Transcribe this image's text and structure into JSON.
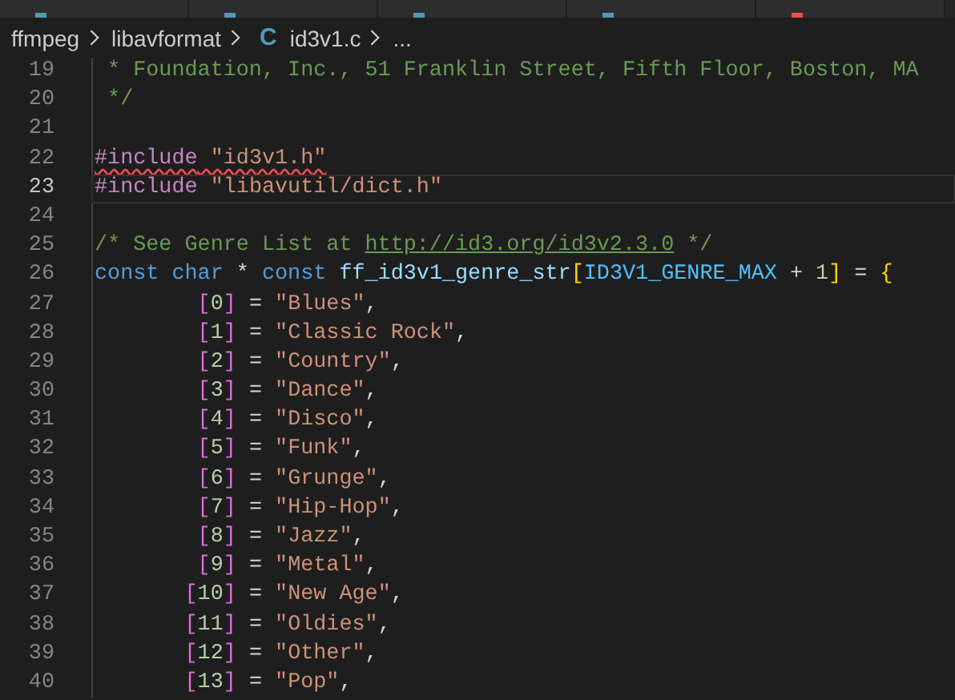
{
  "tabs": [
    {
      "modified": false
    },
    {
      "modified": false
    },
    {
      "modified": false
    },
    {
      "modified": false
    },
    {
      "modified": true
    }
  ],
  "breadcrumbs": {
    "items": [
      "ffmpeg",
      "libavformat"
    ],
    "file_icon": "C",
    "file": "id3v1.c",
    "more": "..."
  },
  "editor": {
    "lines": [
      {
        "number": "19",
        "current": false,
        "error": false,
        "tokens": [
          {
            "kind": "comment",
            "text": " * Foundation, Inc., 51 Franklin Street, Fifth Floor, Boston, MA"
          }
        ]
      },
      {
        "number": "20",
        "current": false,
        "error": false,
        "tokens": [
          {
            "kind": "comment",
            "text": " */"
          }
        ]
      },
      {
        "number": "21",
        "current": false,
        "error": false
      },
      {
        "number": "22",
        "current": false,
        "error": true,
        "tokens": [
          {
            "kind": "preproc",
            "text": "#include"
          },
          {
            "kind": "string",
            "text": " \"id3v1.h\""
          }
        ]
      },
      {
        "number": "23",
        "current": true,
        "error": false,
        "tokens": [
          {
            "kind": "preproc",
            "text": "#include"
          },
          {
            "kind": "string",
            "text": " \"libavutil/dict.h\""
          }
        ]
      },
      {
        "number": "24",
        "current": false,
        "error": false
      },
      {
        "number": "25",
        "current": false,
        "error": false,
        "tokens": [
          {
            "kind": "comment",
            "text": "/* See Genre List at "
          },
          {
            "kind": "link",
            "text": "http://id3.org/id3v2.3.0"
          },
          {
            "kind": "comment",
            "text": " */"
          }
        ]
      },
      {
        "number": "26",
        "current": false,
        "error": false,
        "tokens": [
          {
            "kind": "keyword",
            "text": "const char"
          },
          {
            "kind": "plain",
            "text": " * "
          },
          {
            "kind": "keyword",
            "text": "const"
          },
          {
            "kind": "variable",
            "text": " ff_id3v1_genre_str"
          },
          {
            "kind": "bracket",
            "text": "["
          },
          {
            "kind": "macro",
            "text": "ID3V1_GENRE_MAX"
          },
          {
            "kind": "plain",
            "text": " + "
          },
          {
            "kind": "number",
            "text": "1"
          },
          {
            "kind": "bracket",
            "text": "]"
          },
          {
            "kind": "plain",
            "text": " = "
          },
          {
            "kind": "bracket",
            "text": "{"
          }
        ]
      },
      {
        "number": "27",
        "current": false,
        "error": false,
        "tokens": [
          {
            "kind": "bracket2",
            "text": "        ["
          },
          {
            "kind": "number",
            "text": "0"
          },
          {
            "kind": "bracket2",
            "text": "]"
          },
          {
            "kind": "plain",
            "text": " = "
          },
          {
            "kind": "string",
            "text": "\"Blues\""
          },
          {
            "kind": "plain",
            "text": ","
          }
        ]
      },
      {
        "number": "28",
        "current": false,
        "error": false,
        "tokens": [
          {
            "kind": "bracket2",
            "text": "        ["
          },
          {
            "kind": "number",
            "text": "1"
          },
          {
            "kind": "bracket2",
            "text": "]"
          },
          {
            "kind": "plain",
            "text": " = "
          },
          {
            "kind": "string",
            "text": "\"Classic Rock\""
          },
          {
            "kind": "plain",
            "text": ","
          }
        ]
      },
      {
        "number": "29",
        "current": false,
        "error": false,
        "tokens": [
          {
            "kind": "bracket2",
            "text": "        ["
          },
          {
            "kind": "number",
            "text": "2"
          },
          {
            "kind": "bracket2",
            "text": "]"
          },
          {
            "kind": "plain",
            "text": " = "
          },
          {
            "kind": "string",
            "text": "\"Country\""
          },
          {
            "kind": "plain",
            "text": ","
          }
        ]
      },
      {
        "number": "30",
        "current": false,
        "error": false,
        "tokens": [
          {
            "kind": "bracket2",
            "text": "        ["
          },
          {
            "kind": "number",
            "text": "3"
          },
          {
            "kind": "bracket2",
            "text": "]"
          },
          {
            "kind": "plain",
            "text": " = "
          },
          {
            "kind": "string",
            "text": "\"Dance\""
          },
          {
            "kind": "plain",
            "text": ","
          }
        ]
      },
      {
        "number": "31",
        "current": false,
        "error": false,
        "tokens": [
          {
            "kind": "bracket2",
            "text": "        ["
          },
          {
            "kind": "number",
            "text": "4"
          },
          {
            "kind": "bracket2",
            "text": "]"
          },
          {
            "kind": "plain",
            "text": " = "
          },
          {
            "kind": "string",
            "text": "\"Disco\""
          },
          {
            "kind": "plain",
            "text": ","
          }
        ]
      },
      {
        "number": "32",
        "current": false,
        "error": false,
        "tokens": [
          {
            "kind": "bracket2",
            "text": "        ["
          },
          {
            "kind": "number",
            "text": "5"
          },
          {
            "kind": "bracket2",
            "text": "]"
          },
          {
            "kind": "plain",
            "text": " = "
          },
          {
            "kind": "string",
            "text": "\"Funk\""
          },
          {
            "kind": "plain",
            "text": ","
          }
        ]
      },
      {
        "number": "33",
        "current": false,
        "error": false,
        "tokens": [
          {
            "kind": "bracket2",
            "text": "        ["
          },
          {
            "kind": "number",
            "text": "6"
          },
          {
            "kind": "bracket2",
            "text": "]"
          },
          {
            "kind": "plain",
            "text": " = "
          },
          {
            "kind": "string",
            "text": "\"Grunge\""
          },
          {
            "kind": "plain",
            "text": ","
          }
        ]
      },
      {
        "number": "34",
        "current": false,
        "error": false,
        "tokens": [
          {
            "kind": "bracket2",
            "text": "        ["
          },
          {
            "kind": "number",
            "text": "7"
          },
          {
            "kind": "bracket2",
            "text": "]"
          },
          {
            "kind": "plain",
            "text": " = "
          },
          {
            "kind": "string",
            "text": "\"Hip-Hop\""
          },
          {
            "kind": "plain",
            "text": ","
          }
        ]
      },
      {
        "number": "35",
        "current": false,
        "error": false,
        "tokens": [
          {
            "kind": "bracket2",
            "text": "        ["
          },
          {
            "kind": "number",
            "text": "8"
          },
          {
            "kind": "bracket2",
            "text": "]"
          },
          {
            "kind": "plain",
            "text": " = "
          },
          {
            "kind": "string",
            "text": "\"Jazz\""
          },
          {
            "kind": "plain",
            "text": ","
          }
        ]
      },
      {
        "number": "36",
        "current": false,
        "error": false,
        "tokens": [
          {
            "kind": "bracket2",
            "text": "        ["
          },
          {
            "kind": "number",
            "text": "9"
          },
          {
            "kind": "bracket2",
            "text": "]"
          },
          {
            "kind": "plain",
            "text": " = "
          },
          {
            "kind": "string",
            "text": "\"Metal\""
          },
          {
            "kind": "plain",
            "text": ","
          }
        ]
      },
      {
        "number": "37",
        "current": false,
        "error": false,
        "tokens": [
          {
            "kind": "bracket2",
            "text": "       ["
          },
          {
            "kind": "number",
            "text": "10"
          },
          {
            "kind": "bracket2",
            "text": "]"
          },
          {
            "kind": "plain",
            "text": " = "
          },
          {
            "kind": "string",
            "text": "\"New Age\""
          },
          {
            "kind": "plain",
            "text": ","
          }
        ]
      },
      {
        "number": "38",
        "current": false,
        "error": false,
        "tokens": [
          {
            "kind": "bracket2",
            "text": "       ["
          },
          {
            "kind": "number",
            "text": "11"
          },
          {
            "kind": "bracket2",
            "text": "]"
          },
          {
            "kind": "plain",
            "text": " = "
          },
          {
            "kind": "string",
            "text": "\"Oldies\""
          },
          {
            "kind": "plain",
            "text": ","
          }
        ]
      },
      {
        "number": "39",
        "current": false,
        "error": false,
        "tokens": [
          {
            "kind": "bracket2",
            "text": "       ["
          },
          {
            "kind": "number",
            "text": "12"
          },
          {
            "kind": "bracket2",
            "text": "]"
          },
          {
            "kind": "plain",
            "text": " = "
          },
          {
            "kind": "string",
            "text": "\"Other\""
          },
          {
            "kind": "plain",
            "text": ","
          }
        ]
      },
      {
        "number": "40",
        "current": false,
        "error": false,
        "tokens": [
          {
            "kind": "bracket2",
            "text": "       ["
          },
          {
            "kind": "number",
            "text": "13"
          },
          {
            "kind": "bracket2",
            "text": "]"
          },
          {
            "kind": "plain",
            "text": " = "
          },
          {
            "kind": "string",
            "text": "\"Pop\""
          },
          {
            "kind": "plain",
            "text": ","
          }
        ]
      }
    ]
  }
}
